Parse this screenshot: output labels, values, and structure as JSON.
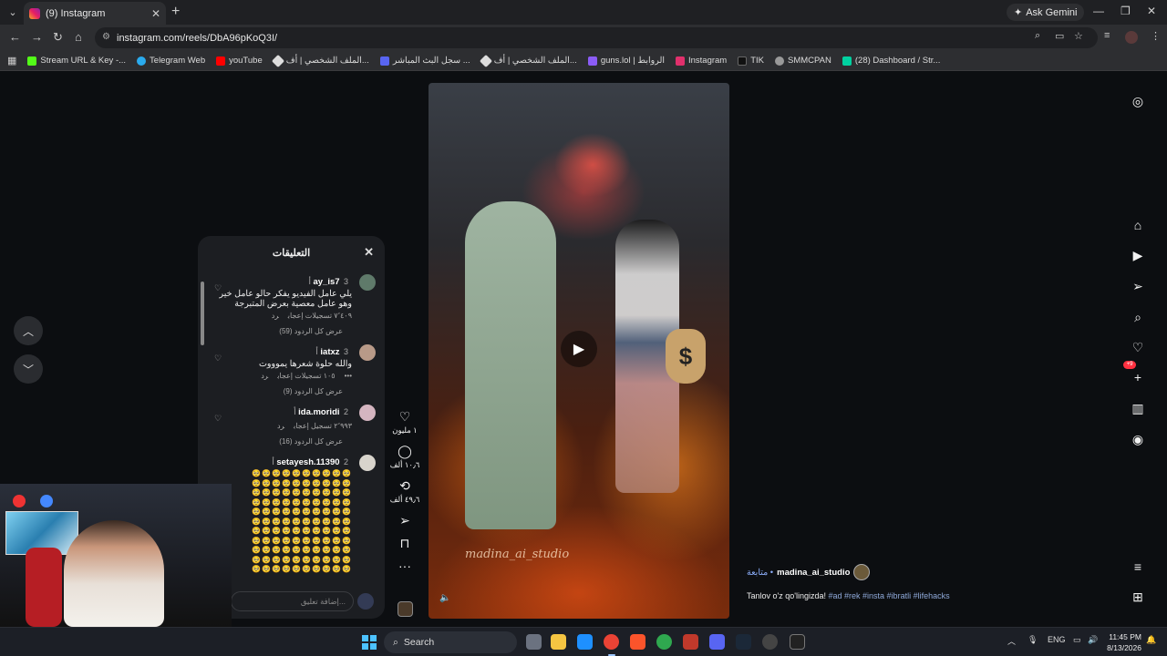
{
  "browser": {
    "tab_title": "(9) Instagram",
    "url": "instagram.com/reels/DbA96pKoQ3I/",
    "ask_gemini": "Ask Gemini",
    "bookmarks": [
      {
        "label": "Stream URL & Key -...",
        "color": "#53fc18"
      },
      {
        "label": "Telegram Web",
        "color": "#2aabee"
      },
      {
        "label": "youTube",
        "color": "#ff0000"
      },
      {
        "label": "الملف الشخصي | أف...",
        "color": "#dddddd"
      },
      {
        "label": "سجل البث المباشر ...",
        "color": "#5865f2"
      },
      {
        "label": "الملف الشخصي | أف...",
        "color": "#dddddd"
      },
      {
        "label": "guns.lol | الروابط",
        "color": "#8b5cf6"
      },
      {
        "label": "Instagram",
        "color": "#e1306c"
      },
      {
        "label": "TIK",
        "color": "#111111"
      },
      {
        "label": "SMMCPAN",
        "color": "#999999"
      },
      {
        "label": "(28) Dashboard / Str...",
        "color": "#00d1a0"
      }
    ]
  },
  "comments": {
    "title": "التعليقات",
    "items": [
      {
        "user": "ay_is7",
        "time": "3 أ",
        "text": "يلي عامل الفيديو يفكر حالو عامل خير وهو عامل معصية بعرض المتبرجة",
        "likes": "٧٬٤٠٩ تسجيلات إعجاب",
        "reply": "رد",
        "replies": "عرض كل الردود (59)",
        "avatar": "#5f7a6a"
      },
      {
        "user": "iatxz",
        "time": "3 أ",
        "text": "والله حلوة شعرها يموووت",
        "likes": "١٠٥ تسجيلات إعجاب",
        "reply": "رد",
        "replies": "عرض كل الردود (9)",
        "avatar": "#b89a88"
      },
      {
        "user": "ida.moridi",
        "time": "2 أ",
        "text": "",
        "likes": "٢٬٩٩٣ تسجيل إعجاب",
        "reply": "رد",
        "replies": "عرض كل الردود (16)",
        "avatar": "#d4b5c0"
      },
      {
        "user": "setayesh.11390",
        "time": "2 أ",
        "text": "",
        "likes": "",
        "reply": "",
        "replies": "",
        "avatar": "#d8d4cc"
      }
    ],
    "emoji_row": "🥺🥺🥺🥺🥺🥺🥺🥺🥺🥺",
    "input_placeholder": "إضافة تعليق..."
  },
  "reel_actions": {
    "likes": "١ مليون",
    "comments": "١٠٫٦ ألف",
    "reposts": "٤٩٫٦ ألف"
  },
  "video": {
    "watermark": "madina_ai_studio"
  },
  "post": {
    "author": "madina_ai_studio",
    "follow": "متابعة •",
    "caption_text": "Tanlov o'z qo'lingizda!",
    "tags": "#ad #rek #insta #ibratli #lifehacks"
  },
  "sidebar": {
    "notifications_badge": "+9"
  },
  "taskbar": {
    "search": "Search",
    "lang": "ENG",
    "time": "11:45 PM",
    "date": "8/13/2026"
  }
}
